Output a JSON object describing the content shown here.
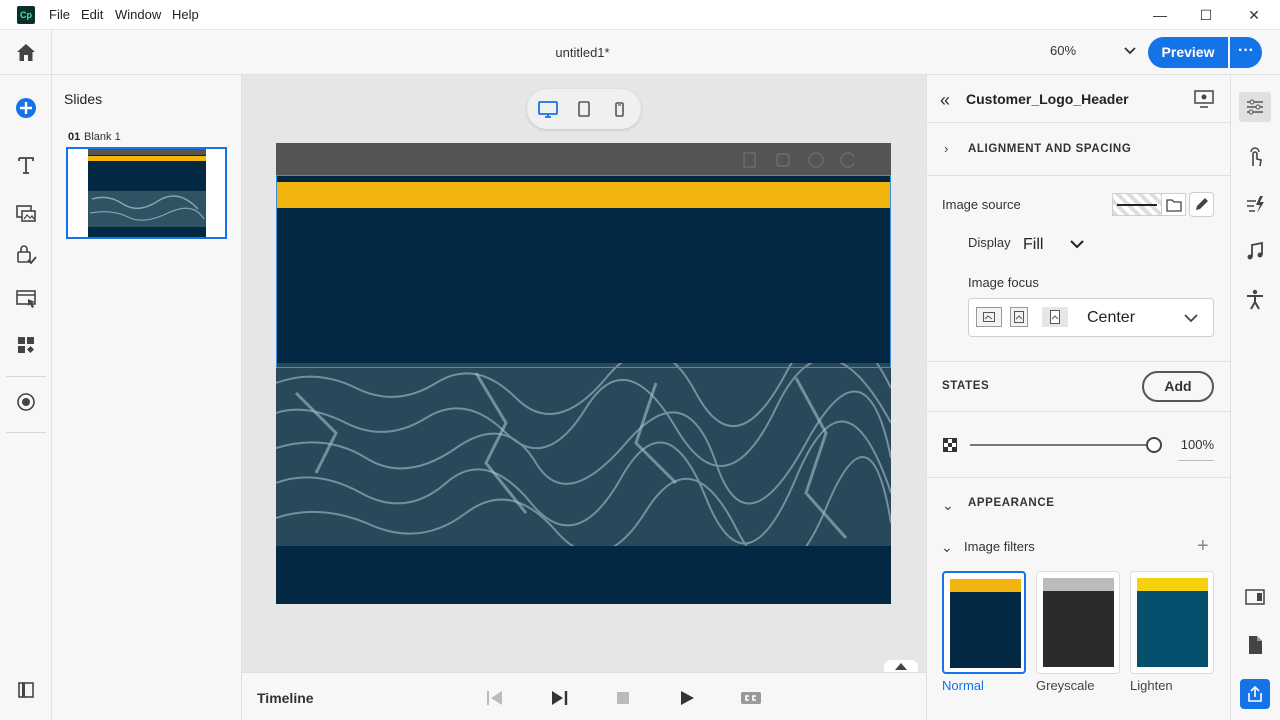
{
  "app": {
    "logo_text": "Cp"
  },
  "menu": {
    "file": "File",
    "edit": "Edit",
    "window": "Window",
    "help": "Help"
  },
  "window_controls": {
    "minimize": "—",
    "maximize": "☐",
    "close": "✕"
  },
  "header": {
    "doc_title": "untitled1*",
    "zoom": "60%",
    "zoom_chev": "⌄",
    "preview_label": "Preview",
    "more_label": "···"
  },
  "slides": {
    "title": "Slides",
    "items": [
      {
        "number": "01",
        "name": "Blank 1"
      }
    ]
  },
  "timeline": {
    "label": "Timeline"
  },
  "properties": {
    "back_glyph": "«",
    "object_name": "Customer_Logo_Header",
    "alignment": {
      "label": "ALIGNMENT AND SPACING",
      "chev": "›"
    },
    "image_source_label": "Image source",
    "display_label": "Display",
    "display_value": "Fill",
    "image_focus_label": "Image focus",
    "image_focus_value": "Center",
    "states": {
      "label": "STATES",
      "add_label": "Add"
    },
    "opacity": {
      "value": "100%",
      "fraction": 1.0
    },
    "appearance": {
      "label": "APPEARANCE",
      "chev": "⌄"
    },
    "image_filters": {
      "label": "Image filters",
      "chev": "⌄",
      "add_glyph": "+",
      "items": [
        {
          "label": "Normal",
          "top_color": "#f2b40f",
          "bottom_color": "#032843",
          "selected": true
        },
        {
          "label": "Greyscale",
          "top_color": "#bbbbbb",
          "bottom_color": "#2b2b2b",
          "selected": false
        },
        {
          "label": "Lighten",
          "top_color": "#f5d20e",
          "bottom_color": "#05506c",
          "selected": false
        }
      ]
    }
  },
  "colors": {
    "accent": "#1473e6",
    "stage_bg": "#032843",
    "stage_yellow": "#f2b40f",
    "stage_topbar": "#545454"
  },
  "icons": {
    "left_toolbar": [
      "home-icon",
      "add-icon",
      "text-icon",
      "media-icon",
      "interactions-icon",
      "widgets-icon",
      "assets-icon",
      "record-icon",
      "panel-toggle-icon"
    ],
    "device_switch": [
      "desktop-icon",
      "tablet-icon",
      "mobile-icon"
    ],
    "timeline": [
      "skip-back-icon",
      "play-step-icon",
      "stop-icon",
      "play-icon",
      "closed-caption-icon"
    ],
    "right_rail": [
      "properties-icon",
      "interactions-icon",
      "effects-icon",
      "audio-icon",
      "accessibility-icon",
      "slide-properties-icon",
      "document-icon",
      "share-icon"
    ]
  }
}
